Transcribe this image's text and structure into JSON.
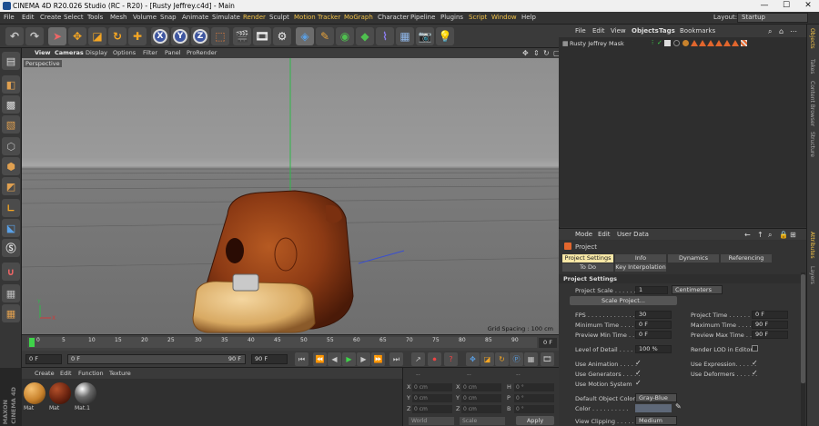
{
  "window": {
    "title": "CINEMA 4D R20.026 Studio (RC - R20) - [Rusty Jeffrey.c4d] - Main",
    "min": "—",
    "max": "☐",
    "close": "✕"
  },
  "menubar": {
    "items": [
      "File",
      "Edit",
      "Create",
      "Select",
      "Tools",
      "Mesh",
      "Volume",
      "Snap",
      "Animate",
      "Simulate",
      "Render",
      "Sculpt",
      "Motion Tracker",
      "MoGraph",
      "Character",
      "Pipeline",
      "Plugins",
      "Script",
      "Window",
      "Help"
    ],
    "layout_label": "Layout:",
    "layout_value": "Startup"
  },
  "toolbar": {
    "undo": "↶",
    "redo": "↷",
    "axis_x": "X",
    "axis_y": "Y",
    "axis_z": "Z"
  },
  "viewport": {
    "menu": [
      "View",
      "Cameras",
      "Display",
      "Options",
      "Filter",
      "Panel",
      "ProRender"
    ],
    "view_name": "Perspective",
    "grid_spacing": "Grid Spacing : 100 cm"
  },
  "timeline": {
    "ticks": [
      "0",
      "5",
      "10",
      "15",
      "20",
      "25",
      "30",
      "35",
      "40",
      "45",
      "50",
      "55",
      "60",
      "65",
      "70",
      "75",
      "80",
      "85",
      "90"
    ],
    "end_frame": "0 F"
  },
  "transport": {
    "current_frame": "0 F",
    "min_frame": "0 F",
    "preview_max": "90 F",
    "max_frame": "90 F"
  },
  "materials": {
    "menu": [
      "Create",
      "Edit",
      "Function",
      "Texture"
    ],
    "items": [
      {
        "name": "Mat",
        "color": "#c8822c"
      },
      {
        "name": "Mat",
        "color": "#6b2410"
      },
      {
        "name": "Mat.1",
        "color": "#2a2a2a"
      }
    ],
    "brand_line1": "MAXON",
    "brand_line2": "CINEMA 4D"
  },
  "coordinates": {
    "header1": "--",
    "header2": "--",
    "header3": "--",
    "rows": [
      {
        "axis": "X",
        "pos": "0 cm",
        "axis2": "X",
        "size": "0 cm",
        "axis3": "H",
        "rot": "0 °"
      },
      {
        "axis": "Y",
        "pos": "0 cm",
        "axis2": "Y",
        "size": "0 cm",
        "axis3": "P",
        "rot": "0 °"
      },
      {
        "axis": "Z",
        "pos": "0 cm",
        "axis2": "Z",
        "size": "0 cm",
        "axis3": "B",
        "rot": "0 °"
      }
    ],
    "mode1": "World",
    "mode2": "Scale",
    "apply": "Apply"
  },
  "object_manager": {
    "menu": [
      "File",
      "Edit",
      "View",
      "Objects",
      "Tags",
      "Bookmarks"
    ],
    "object_name": "Rusty Jeffrey Mask"
  },
  "attributes": {
    "menu": [
      "Mode",
      "Edit",
      "User Data"
    ],
    "title": "Project",
    "tabs_row1": [
      "Project Settings",
      "Info",
      "Dynamics",
      "Referencing"
    ],
    "tabs_row2": [
      "To Do",
      "Key Interpolation"
    ],
    "section": "Project Settings",
    "project_scale_label": "Project Scale . . . . . .",
    "project_scale_value": "1",
    "project_scale_unit": "Centimeters",
    "scale_button": "Scale Project...",
    "fps_label": "FPS . . . . . . . . . . . . . .",
    "fps_value": "30",
    "project_time_label": "Project Time . . . . . . .",
    "project_time_value": "0 F",
    "min_time_label": "Minimum Time . . . . .",
    "min_time_value": "0 F",
    "max_time_label": "Maximum Time . . . . .",
    "max_time_value": "90 F",
    "prev_min_label": "Preview Min Time . . .",
    "prev_min_value": "0 F",
    "prev_max_label": "Preview Max Time . . .",
    "prev_max_value": "90 F",
    "lod_label": "Level of Detail . . . . .",
    "lod_value": "100 %",
    "render_lod_label": "Render LOD in Editor",
    "use_anim_label": "Use Animation . . . . .",
    "use_expr_label": "Use Expression. . . . . .",
    "use_gen_label": "Use Generators . . . . .",
    "use_def_label": "Use Deformers . . . . . .",
    "use_motion_label": "Use Motion System",
    "check": "✓",
    "default_color_label": "Default Object Color",
    "default_color_value": "Gray-Blue",
    "color_label": "Color . . . . . . . . . .",
    "view_clipping_label": "View Clipping . . . . . .",
    "view_clipping_value": "Medium"
  },
  "side_tabs": [
    "Objects",
    "Takes",
    "Content Browser",
    "Structure"
  ],
  "side_tabs2": [
    "Attributes",
    "Layers"
  ]
}
